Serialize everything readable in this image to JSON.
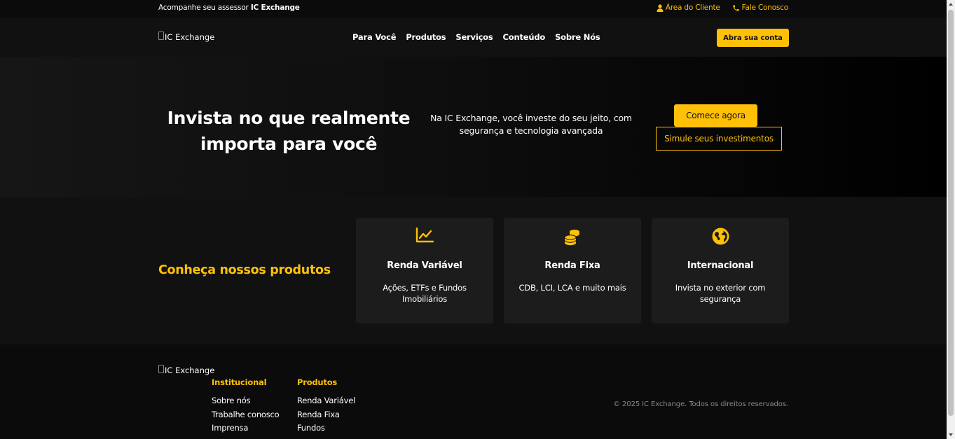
{
  "topbar": {
    "assessor_prefix": "Acompanhe seu assessor",
    "assessor_brand": "IC Exchange",
    "client_area": "Área do Cliente",
    "contact": "Fale Conosco"
  },
  "header": {
    "logo_alt": "IC Exchange",
    "nav": [
      "Para Você",
      "Produtos",
      "Serviços",
      "Conteúdo",
      "Sobre Nós"
    ],
    "cta": "Abra sua conta"
  },
  "hero": {
    "title_line1": "Invista no que realmente",
    "title_line2": "importa para você",
    "desc_line1": "Na IC Exchange, você investe do seu jeito, com",
    "desc_line2": "segurança e tecnologia avançada",
    "primary_btn": "Comece agora",
    "secondary_btn": "Simule seus investimentos"
  },
  "products": {
    "heading": "Conheça nossos produtos",
    "cards": [
      {
        "icon": "chart-line-icon",
        "title": "Renda Variável",
        "line1": "Ações, ETFs e Fundos",
        "line2": "Imobiliários"
      },
      {
        "icon": "coins-icon",
        "title": "Renda Fixa",
        "line1": "CDB, LCI, LCA e muito mais",
        "line2": ""
      },
      {
        "icon": "globe-icon",
        "title": "Internacional",
        "line1": "Invista no exterior com",
        "line2": "segurança"
      }
    ]
  },
  "footer": {
    "logo_alt": "IC Exchange",
    "columns": [
      {
        "title": "Institucional",
        "links": [
          "Sobre nós",
          "Trabalhe conosco",
          "Imprensa"
        ]
      },
      {
        "title": "Produtos",
        "links": [
          "Renda Variável",
          "Renda Fixa",
          "Fundos"
        ]
      }
    ],
    "copyright": "© 2025 IC Exchange. Todos os direitos reservados."
  },
  "colors": {
    "accent": "#FFC107",
    "background": "#111111",
    "card": "#1c1c1c"
  }
}
